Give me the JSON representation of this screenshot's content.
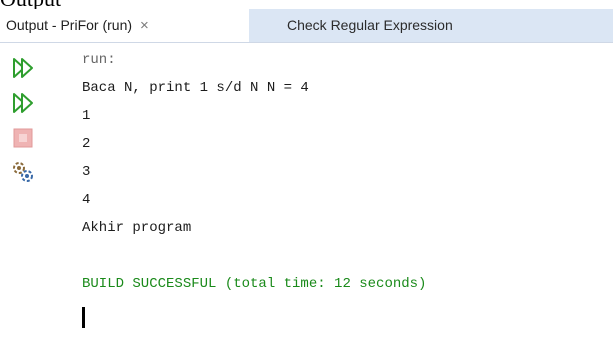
{
  "doc_caption": "Output",
  "tabs": [
    {
      "label": "Output - PriFor (run)",
      "close": "×"
    },
    {
      "label": "Check Regular Expression"
    }
  ],
  "gutter": {
    "icons": [
      "rerun-icon",
      "rerun-with-options-icon",
      "stop-icon",
      "settings-icon"
    ]
  },
  "console": {
    "lines": [
      {
        "text": "run:",
        "style": "muted"
      },
      {
        "text": "Baca N, print 1 s/d N N = 4",
        "style": "normal"
      },
      {
        "text": "1",
        "style": "normal"
      },
      {
        "text": "2",
        "style": "normal"
      },
      {
        "text": "3",
        "style": "normal"
      },
      {
        "text": "4",
        "style": "normal"
      },
      {
        "text": "Akhir program",
        "style": "normal"
      },
      {
        "text": "",
        "style": "normal"
      },
      {
        "text": "BUILD SUCCESSFUL (total time: 12 seconds)",
        "style": "ok"
      }
    ]
  },
  "colors": {
    "build_success": "#1a8a1a",
    "inactive_tab": "#dbe6f4",
    "run_icon": "#2e9e2e"
  }
}
